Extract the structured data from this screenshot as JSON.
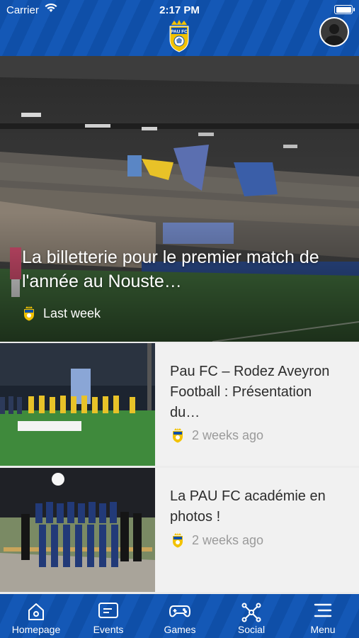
{
  "status_bar": {
    "carrier": "Carrier",
    "time": "2:17 PM"
  },
  "header": {
    "logo_text": "PAU FC"
  },
  "hero": {
    "title": "La billetterie pour le premier match de l'année au Nouste…",
    "time": "Last week"
  },
  "articles": [
    {
      "title": "Pau FC – Rodez Aveyron Football : Présentation du…",
      "time": "2 weeks ago"
    },
    {
      "title": "La PAU FC académie en photos !",
      "time": "2 weeks ago"
    }
  ],
  "tabs": [
    {
      "label": "Homepage",
      "icon": "home-icon"
    },
    {
      "label": "Events",
      "icon": "message-icon"
    },
    {
      "label": "Games",
      "icon": "gamepad-icon"
    },
    {
      "label": "Social",
      "icon": "network-icon"
    },
    {
      "label": "Menu",
      "icon": "menu-icon"
    }
  ],
  "colors": {
    "brand_blue": "#0f4fa8",
    "crest_gold": "#f2c200"
  }
}
